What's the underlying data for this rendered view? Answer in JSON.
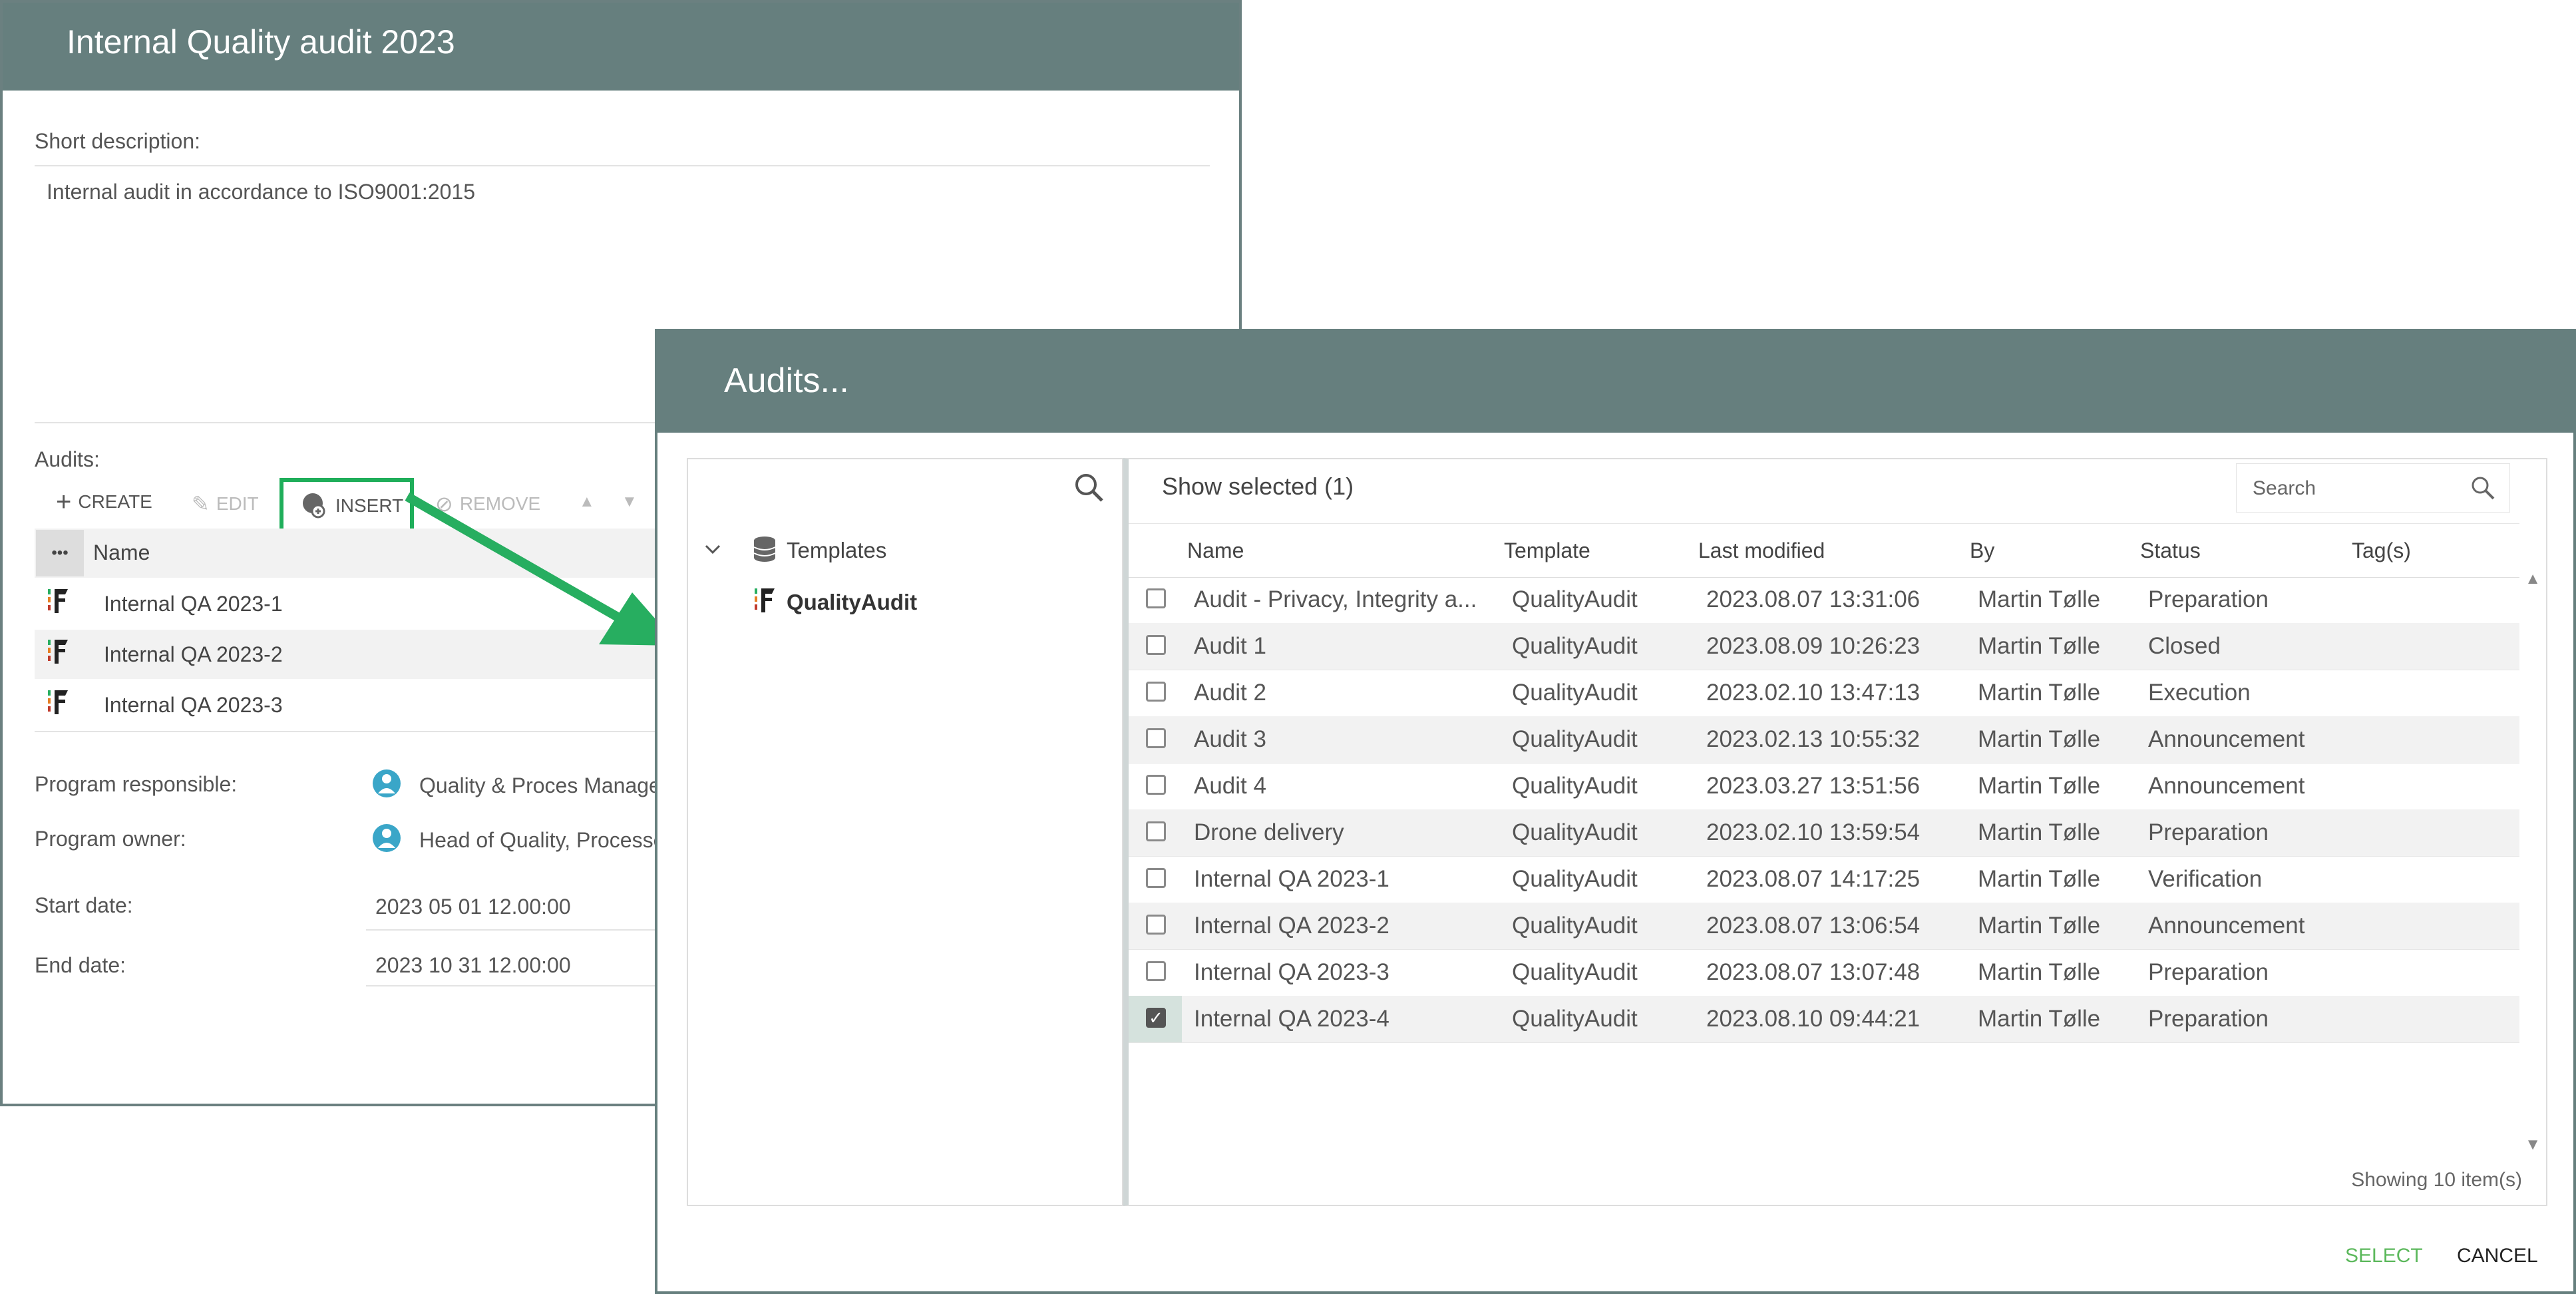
{
  "main_window": {
    "title": "Internal Quality audit 2023",
    "short_description_label": "Short description:",
    "short_description_value": "Internal audit in accordance to ISO9001:2015",
    "audits_label": "Audits:",
    "toolbar": {
      "create": "CREATE",
      "edit": "EDIT",
      "insert": "INSERT",
      "remove": "REMOVE"
    },
    "list_header": {
      "more": "•••",
      "name": "Name"
    },
    "audits": [
      "Internal QA 2023-1",
      "Internal QA 2023-2",
      "Internal QA 2023-3"
    ],
    "program_responsible_label": "Program responsible:",
    "program_responsible_value": "Quality & Proces Manager",
    "program_owner_label": "Program owner:",
    "program_owner_value": "Head of Quality, Processe",
    "start_date_label": "Start date:",
    "start_date_value": "2023 05 01 12.00:00",
    "end_date_label": "End date:",
    "end_date_value": "2023 10 31 12.00:00"
  },
  "dialog": {
    "title": "Audits...",
    "tree": {
      "root": "Templates",
      "child": "QualityAudit"
    },
    "show_selected": "Show selected (1)",
    "search_placeholder": "Search",
    "columns": {
      "name": "Name",
      "template": "Template",
      "last_modified": "Last modified",
      "by": "By",
      "status": "Status",
      "tags": "Tag(s)"
    },
    "rows": [
      {
        "name": "Audit - Privacy, Integrity a...",
        "template": "QualityAudit",
        "modified": "2023.08.07 13:31:06",
        "by": "Martin Tølle",
        "status": "Preparation",
        "checked": false
      },
      {
        "name": "Audit 1",
        "template": "QualityAudit",
        "modified": "2023.08.09 10:26:23",
        "by": "Martin Tølle",
        "status": "Closed",
        "checked": false
      },
      {
        "name": "Audit 2",
        "template": "QualityAudit",
        "modified": "2023.02.10 13:47:13",
        "by": "Martin Tølle",
        "status": "Execution",
        "checked": false
      },
      {
        "name": "Audit 3",
        "template": "QualityAudit",
        "modified": "2023.02.13 10:55:32",
        "by": "Martin Tølle",
        "status": "Announcement",
        "checked": false
      },
      {
        "name": "Audit 4",
        "template": "QualityAudit",
        "modified": "2023.03.27 13:51:56",
        "by": "Martin Tølle",
        "status": "Announcement",
        "checked": false
      },
      {
        "name": "Drone delivery",
        "template": "QualityAudit",
        "modified": "2023.02.10 13:59:54",
        "by": "Martin Tølle",
        "status": "Preparation",
        "checked": false
      },
      {
        "name": "Internal QA 2023-1",
        "template": "QualityAudit",
        "modified": "2023.08.07 14:17:25",
        "by": "Martin Tølle",
        "status": "Verification",
        "checked": false
      },
      {
        "name": "Internal QA 2023-2",
        "template": "QualityAudit",
        "modified": "2023.08.07 13:06:54",
        "by": "Martin Tølle",
        "status": "Announcement",
        "checked": false
      },
      {
        "name": "Internal QA 2023-3",
        "template": "QualityAudit",
        "modified": "2023.08.07 13:07:48",
        "by": "Martin Tølle",
        "status": "Preparation",
        "checked": false
      },
      {
        "name": "Internal QA 2023-4",
        "template": "QualityAudit",
        "modified": "2023.08.10 09:44:21",
        "by": "Martin Tølle",
        "status": "Preparation",
        "checked": true
      }
    ],
    "footer_count": "Showing 10 item(s)",
    "select_button": "SELECT",
    "cancel_button": "CANCEL"
  },
  "colors": {
    "header": "#667f7e",
    "highlight": "#1fae5a",
    "select_text": "#5cb85c"
  },
  "icons": [
    "plus-icon",
    "pencil-icon",
    "insert-link-icon",
    "unlink-icon",
    "arrow-up-icon",
    "arrow-down-icon",
    "audit-template-icon",
    "search-icon",
    "database-icon",
    "chevron-down-icon",
    "user-role-icon",
    "scroll-up-icon",
    "scroll-down-icon",
    "annotation-arrow"
  ]
}
